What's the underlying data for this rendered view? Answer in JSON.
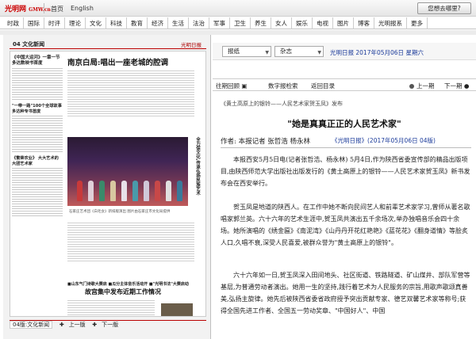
{
  "site": {
    "logo": "光明网",
    "logo_tiny": "GMW.cn"
  },
  "top_nav": [
    "首页",
    "English"
  ],
  "help_button": "您想去哪里?",
  "categories": [
    "时政",
    "国际",
    "时评",
    "理论",
    "文化",
    "科技",
    "教育",
    "经济",
    "生活",
    "法治",
    "军事",
    "卫生",
    "养生",
    "女人",
    "娱乐",
    "电视",
    "图片",
    "博客",
    "光明报系",
    "更多"
  ],
  "newspaper": {
    "section": "04 文化新闻",
    "masthead": "光明日报",
    "headline": "南京白局:唱出一座老城的腔调",
    "left_col_title": "《中国大运河》一章一节 多达数映书首度",
    "left_col_b": "\"一带一路\"100个全球故事 多达种专书首度",
    "left_col_c": "《繁荣农业》 大大艺术的 大团艺术家",
    "vertical_text": "全力保文化,传承弘扬民族艺术",
    "photo_caption": "石家庄艺术团《白毛女》新排版演出 图片由石家庄市文化局提供",
    "tags": [
      "■山东气门诗歌大赛启",
      "■瓜分主体音乐活动开",
      "■\"光明书"
    ],
    "sub_title2": "■山东气门诗歌大赛启  ■瓜分主体音乐活动开  ■\"光明书法\"大赛启动",
    "headline2": "故宫集中发布近期工作情况"
  },
  "page_bottom": {
    "page_name": "04版:文化新闻",
    "prev": "上一版",
    "next": "下一版"
  },
  "controls": {
    "paper": "报纸",
    "type": "杂志",
    "date": "光明日报  2017年05月06日  星期六"
  },
  "toolbar": {
    "back": "往期回顾",
    "search": "数字报检索",
    "home": "返回目录",
    "prev": "上一期",
    "next": "下一期"
  },
  "article": {
    "breadcrumb": "《黄土高原上的银铃——人民艺术家贺玉凤》发布",
    "title": "\"她是真真正正的人民艺术家\"",
    "byline": "作者: 本报记者  张哲浩  杨永林",
    "source": "《光明日报》(2017年05月06日 04版)",
    "para1": "本报西安5月5日电(记者张哲浩、杨永林) 5月4日,作为陕西省委宣传部的精品出版项目,由陕西师范大学出版社出版发行的《黄土高原上的银铃——人民艺术家贺玉凤》新书发布会在西安举行。",
    "para2": "贺玉凤是地道的陕西人。在工作中她不断向民间艺人和前辈艺术家学习,曾师从著名歌唱家郭兰英。六十六年的艺术生涯中,贺玉凤共演出五千余场次,举办独唱音乐会四十余场。她所演唱的《绣金匾》《南泥湾》《山丹丹开花红艳艳》《蓝花花》《翻身道情》等脍炙人口,久唱不衰,深受人民喜爱,被群众誉为\"黄土高原上的银铃\"。",
    "para3": "六十六年如一日,贺玉凤深入田间地头、社区街道、铁路隧道、矿山煤井、部队军营等基层,为普通劳动者演出。她用一生的坚持,践行着艺术为人民服务的宗旨,用歌声歌颂真善美,弘扬主旋律。她先后被陕西省委省政府授予突出贡献专家、德艺双馨艺术家等称号;获得全国先进工作者、全国五一劳动奖章、\"中国好人\"、中国"
  }
}
